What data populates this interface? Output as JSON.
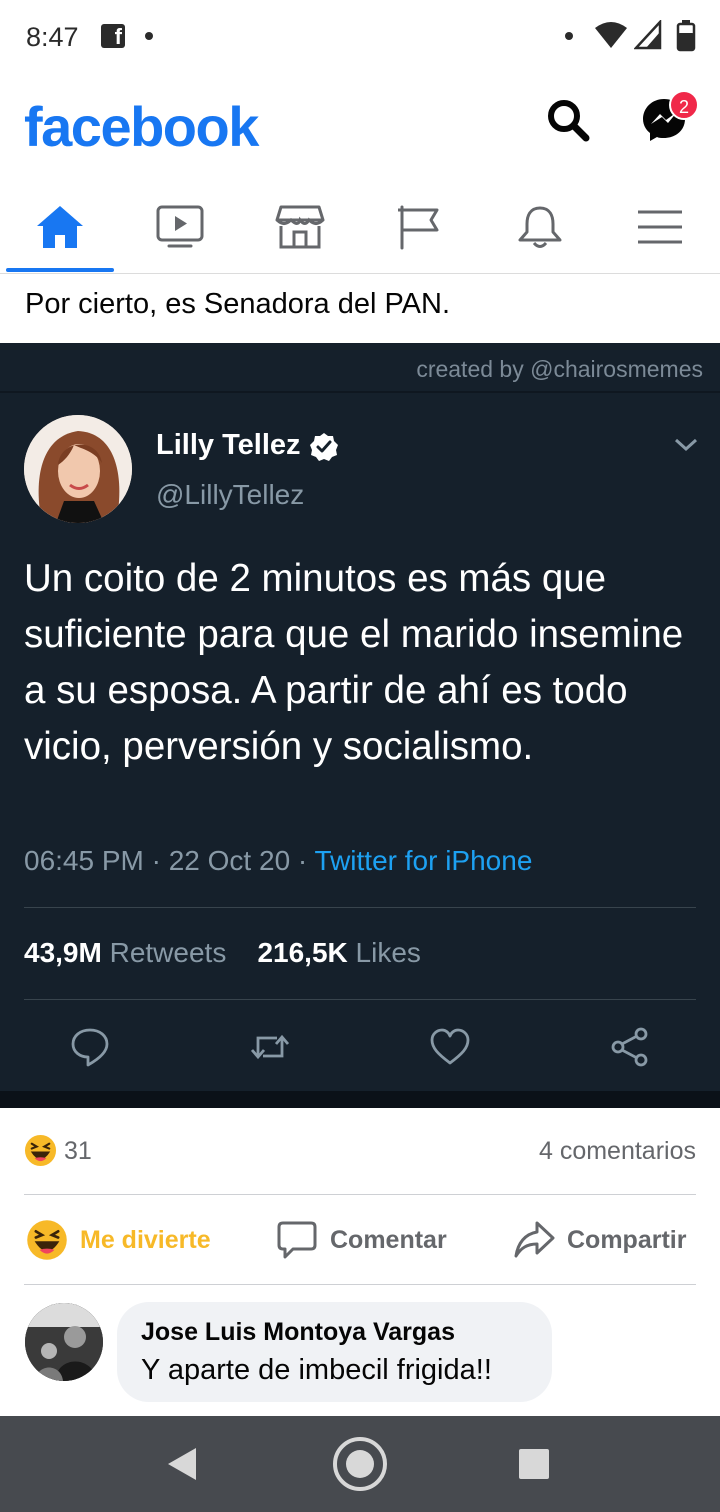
{
  "status_bar": {
    "time": "8:47",
    "fb_notification_icon": "facebook-notification-icon",
    "icons": [
      "wifi-icon",
      "cell-signal-icon",
      "battery-icon"
    ]
  },
  "header": {
    "logo": "facebook",
    "search_icon": "search-icon",
    "messenger_icon": "messenger-icon",
    "messenger_badge": "2",
    "brand_color": "#1877f2",
    "badge_color": "#f02849"
  },
  "nav": {
    "tabs": [
      {
        "name": "home",
        "icon": "home-icon",
        "active": true
      },
      {
        "name": "watch",
        "icon": "video-icon",
        "active": false
      },
      {
        "name": "marketplace",
        "icon": "shop-icon",
        "active": false
      },
      {
        "name": "pages",
        "icon": "flag-icon",
        "active": false
      },
      {
        "name": "notifications",
        "icon": "bell-icon",
        "active": false
      },
      {
        "name": "menu",
        "icon": "hamburger-icon",
        "active": false
      }
    ]
  },
  "post": {
    "caption": "Por cierto, es Senadora del PAN."
  },
  "tweet": {
    "credit": "created by @chairosmemes",
    "author_name": "Lilly Tellez",
    "handle": "@LillyTellez",
    "verified": true,
    "text": "Un coito de 2 minutos es más que suficiente para que el marido insemine a su esposa. A partir de ahí es todo vicio, perversión y socialismo.",
    "timestamp": "06:45 PM · 22 Oct 20 · ",
    "source": "Twitter for iPhone",
    "retweets_count": "43,9M",
    "retweets_label": "Retweets",
    "likes_count": "216,5K",
    "likes_label": "Likes",
    "background_color": "#15202b",
    "link_color": "#1da1f2"
  },
  "reactions": {
    "emoji": "haha-emoji-icon",
    "count": "31",
    "comments": "4 comentarios"
  },
  "actions": {
    "react_label": "Me divierte",
    "comment_label": "Comentar",
    "share_label": "Compartir"
  },
  "comment": {
    "author": "Jose Luis Montoya Vargas",
    "text": "Y aparte de imbecil frigida!!"
  },
  "android_nav": {
    "back": "back-icon",
    "home": "home-circle-icon",
    "recents": "recents-icon"
  }
}
